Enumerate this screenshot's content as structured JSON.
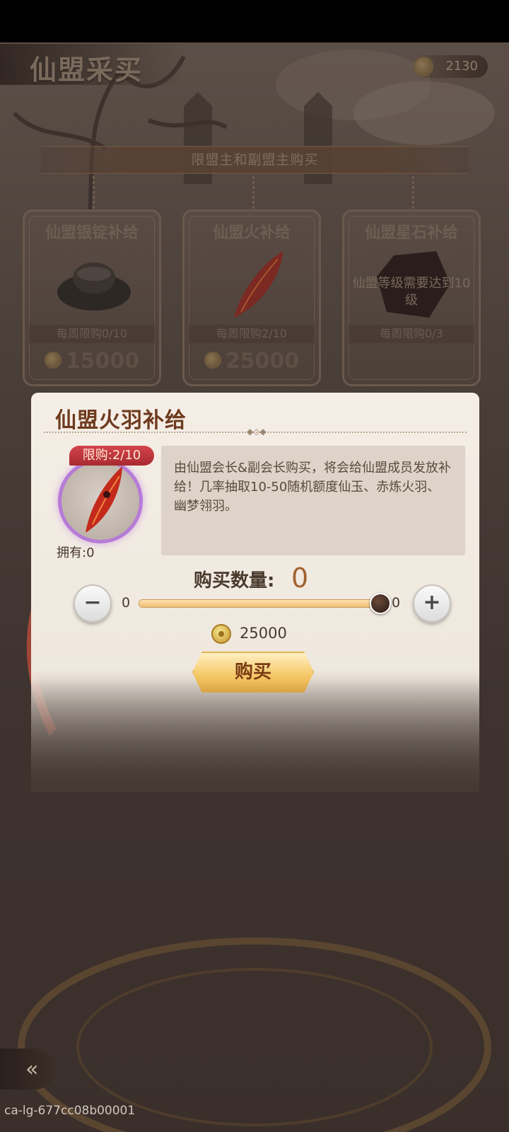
{
  "page_title": "仙盟采买",
  "currency": {
    "icon": "coin-icon",
    "value": "2130"
  },
  "notice": "限盟主和副盟主购买",
  "cards": [
    {
      "title": "仙盟银锭补给",
      "icon": "silver-ingot-icon",
      "limit": "每周限购0/10",
      "price": "15000"
    },
    {
      "title": "仙盟火补给",
      "icon": "fire-feather-icon",
      "limit": "每周限购2/10",
      "price": "25000"
    },
    {
      "title": "仙盟星石补给",
      "icon": "star-stone-icon",
      "requirement": "仙盟等级需要达到10级",
      "limit": "每周限购0/3",
      "price": ""
    }
  ],
  "dialog": {
    "title": "仙盟火羽补给",
    "limit_tag": "限购:2/10",
    "owned": "拥有:0",
    "description": "由仙盟会长&副会长购买，将会给仙盟成员发放补给！几率抽取10-50随机额度仙玉、赤炼火羽、幽梦翎羽。",
    "qty_label": "购买数量:",
    "qty_value": "0",
    "slider_min": "0",
    "slider_max": "0",
    "slider_level": 1.0,
    "minus": "−",
    "plus": "+",
    "price": "25000",
    "buy_label": "购买"
  },
  "back_icon": "back-arrow-icon",
  "watermark": "ca-lg-677cc08b00001"
}
